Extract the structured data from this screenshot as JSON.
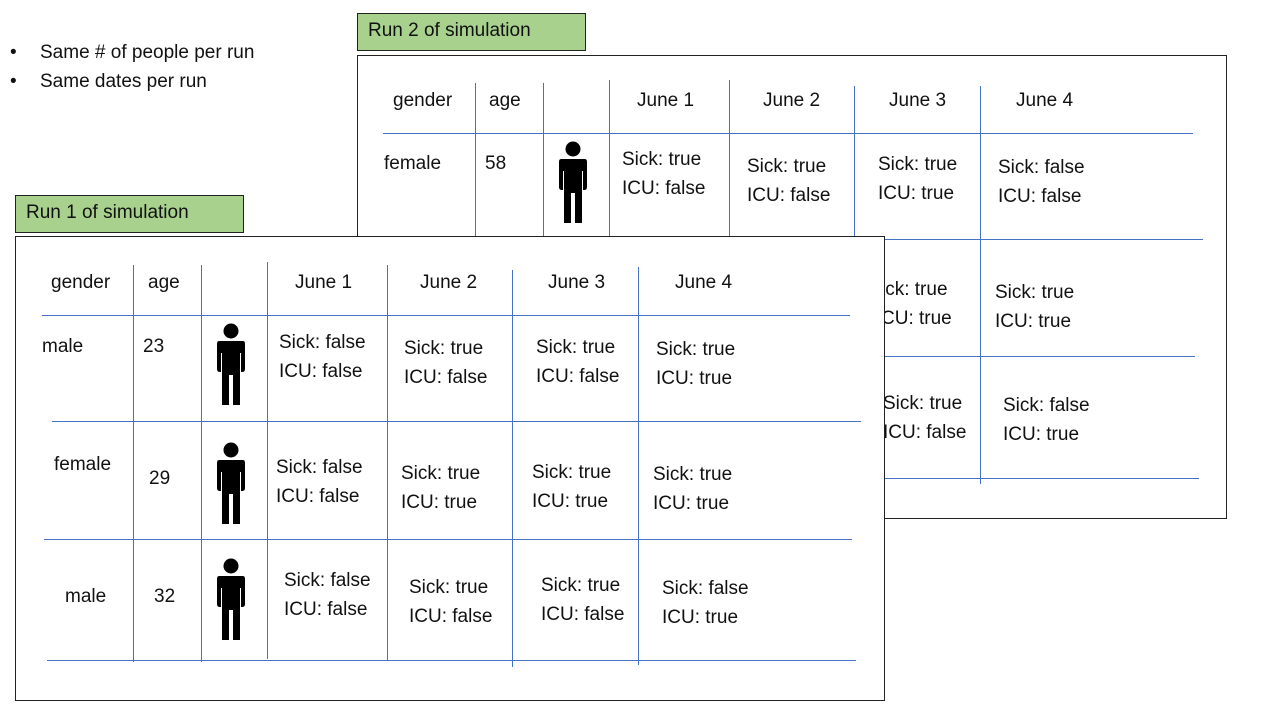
{
  "notes": [
    "Same # of people per run",
    "Same dates per run"
  ],
  "bullet_glyph": "•",
  "colors": {
    "label_bg": "#a9d18e",
    "grid": "#4472c4"
  },
  "run2": {
    "label": "Run 2 of simulation",
    "headers": {
      "gender": "gender",
      "age": "age",
      "dates": [
        "June 1",
        "June 2",
        "June 3",
        "June 4"
      ]
    },
    "rows": [
      {
        "gender": "female",
        "age": "58",
        "icon": "person-icon",
        "cells": [
          [
            "Sick: true",
            "ICU: false"
          ],
          [
            "Sick: true",
            "ICU: false"
          ],
          [
            "Sick: true",
            "ICU: true"
          ],
          [
            "Sick: false",
            "ICU: false"
          ]
        ]
      },
      {
        "cells_visible": [
          [
            "ick: true",
            "CU: true"
          ],
          [
            "Sick: true",
            "ICU: true"
          ]
        ]
      },
      {
        "cells_visible": [
          [
            "Sick: true",
            "ICU: false"
          ],
          [
            "Sick: false",
            "ICU: true"
          ]
        ]
      }
    ]
  },
  "run1": {
    "label": "Run 1 of simulation",
    "headers": {
      "gender": "gender",
      "age": "age",
      "dates": [
        "June 1",
        "June 2",
        "June 3",
        "June 4"
      ]
    },
    "rows": [
      {
        "gender": "male",
        "age": "23",
        "icon": "person-icon",
        "cells": [
          [
            "Sick: false",
            "ICU: false"
          ],
          [
            "Sick: true",
            "ICU: false"
          ],
          [
            "Sick: true",
            "ICU: false"
          ],
          [
            "Sick: true",
            "ICU: true"
          ]
        ]
      },
      {
        "gender": "female",
        "age": "29",
        "icon": "person-icon",
        "cells": [
          [
            "Sick: false",
            "ICU: false"
          ],
          [
            "Sick: true",
            "ICU: true"
          ],
          [
            "Sick: true",
            "ICU: true"
          ],
          [
            "Sick: true",
            "ICU: true"
          ]
        ]
      },
      {
        "gender": "male",
        "age": "32",
        "icon": "person-icon",
        "cells": [
          [
            "Sick: false",
            "ICU: false"
          ],
          [
            "Sick: true",
            "ICU: false"
          ],
          [
            "Sick: true",
            "ICU: false"
          ],
          [
            "Sick: false",
            "ICU: true"
          ]
        ]
      }
    ]
  }
}
